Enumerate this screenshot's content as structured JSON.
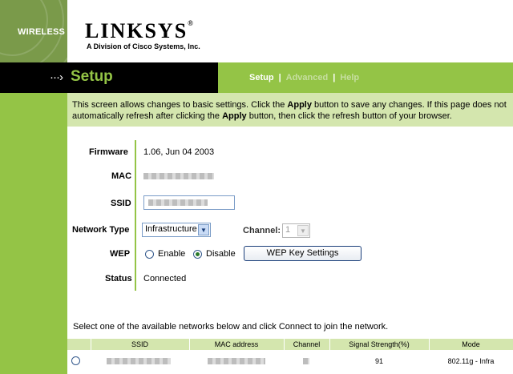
{
  "brand": {
    "side_label": "WIRELESS",
    "logo_text": "LINKSYS",
    "logo_mark": "®",
    "tagline": "A Division of Cisco Systems, Inc."
  },
  "header": {
    "title": "Setup",
    "nav": [
      {
        "label": "Setup",
        "active": true
      },
      {
        "label": "Advanced",
        "active": false
      },
      {
        "label": "Help",
        "active": false
      }
    ],
    "separator": "|"
  },
  "intro": {
    "part1": "This screen allows changes to basic settings. Click the ",
    "bold1": "Apply",
    "part2": " button to save any changes. If this page does not automatically refresh after clicking the ",
    "bold2": "Apply",
    "part3": " button, then click the refresh button of your browser."
  },
  "form": {
    "firmware_label": "Firmware",
    "firmware_value": "1.06, Jun 04 2003",
    "mac_label": "MAC",
    "ssid_label": "SSID",
    "network_type_label": "Network Type",
    "network_type_value": "Infrastructure",
    "channel_label": "Channel:",
    "channel_value": "1",
    "wep_label": "WEP",
    "wep_enable": "Enable",
    "wep_disable": "Disable",
    "wep_selected": "Disable",
    "wep_button": "WEP Key Settings",
    "status_label": "Status",
    "status_value": "Connected"
  },
  "networks": {
    "instruction": "Select one of the available networks below and click Connect to join the network.",
    "columns": [
      "SSID",
      "MAC address",
      "Channel",
      "Signal Strength(%)",
      "Mode"
    ],
    "rows": [
      {
        "signal": "91",
        "mode": "802.11g - Infra"
      }
    ]
  },
  "colors": {
    "accent_green": "#94c446",
    "light_green": "#d4e6ae",
    "black_bar": "#000000"
  }
}
